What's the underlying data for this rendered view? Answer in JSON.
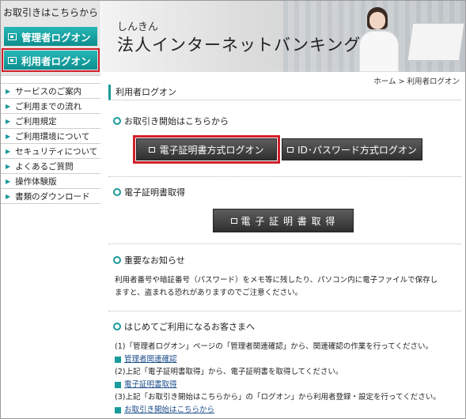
{
  "sidebar": {
    "login_title": "お取引きはこちらから",
    "admin_login": "管理者ログオン",
    "user_login": "利用者ログオン",
    "nav": [
      "サービスのご案内",
      "ご利用までの流れ",
      "ご利用規定",
      "ご利用環境について",
      "セキュリティについて",
      "よくあるご質問",
      "操作体験版",
      "書類のダウンロード"
    ]
  },
  "banner": {
    "subtitle": "しんきん",
    "title": "法人インターネットバンキング"
  },
  "breadcrumb": {
    "home": "ホーム",
    "separator": ">",
    "current": "利用者ログオン"
  },
  "main": {
    "page_title": "利用者ログオン",
    "start_section": {
      "heading": "お取引き開始はこちらから",
      "cert_login": "電子証明書方式ログオン",
      "id_login": "ID･パスワード方式ログオン"
    },
    "cert_section": {
      "heading": "電子証明書取得",
      "button": "電 子 証 明 書 取 得"
    },
    "notice_section": {
      "heading": "重要なお知らせ",
      "line1": "利用者番号や暗証番号（パスワード）をメモ等に残したり、パソコン内に電子ファイルで保存し",
      "line2": "ますと、盗まれる恐れがありますのでご注意ください。"
    },
    "first_section": {
      "heading": "はじめてご利用になるお客さまへ",
      "step1": "(1)「管理者ログオン」ページの「管理者関連確認」から、関連確認の作業を行ってください。",
      "link1": "管理者関連確認",
      "step2": "(2)上記「電子証明書取得」から、電子証明書を取得してください。",
      "link2": "電子証明書取得",
      "step3": "(3)上記「お取引き開始はこちらから」の「ログオン」から利用者登録・設定を行ってください。",
      "link3": "お取引き開始はこちらから"
    }
  },
  "colors": {
    "accent": "#1a9a9a",
    "highlight": "#d0202a"
  }
}
